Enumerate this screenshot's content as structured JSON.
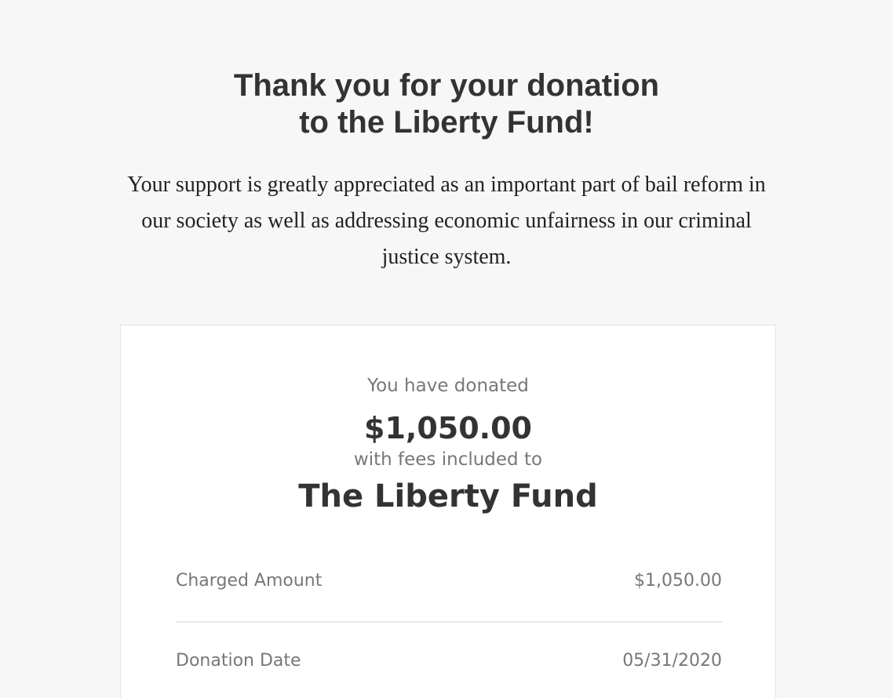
{
  "header": {
    "title_line1": "Thank you for your donation",
    "title_line2": "to the Liberty Fund!"
  },
  "intro": {
    "message": "Your support is greatly appreciated as an important part of bail reform in our society as well as addressing economic unfairness in our criminal justice system."
  },
  "receipt": {
    "donated_label": "You have donated",
    "amount": "$1,050.00",
    "fees_note": "with fees included to",
    "recipient": "The Liberty Fund",
    "details": [
      {
        "label": "Charged Amount",
        "value": "$1,050.00"
      },
      {
        "label": "Donation Date",
        "value": "05/31/2020"
      }
    ]
  },
  "colors": {
    "background": "#f7f7f7",
    "card": "#ffffff",
    "heading_text": "#333333",
    "muted_text": "#777777"
  }
}
